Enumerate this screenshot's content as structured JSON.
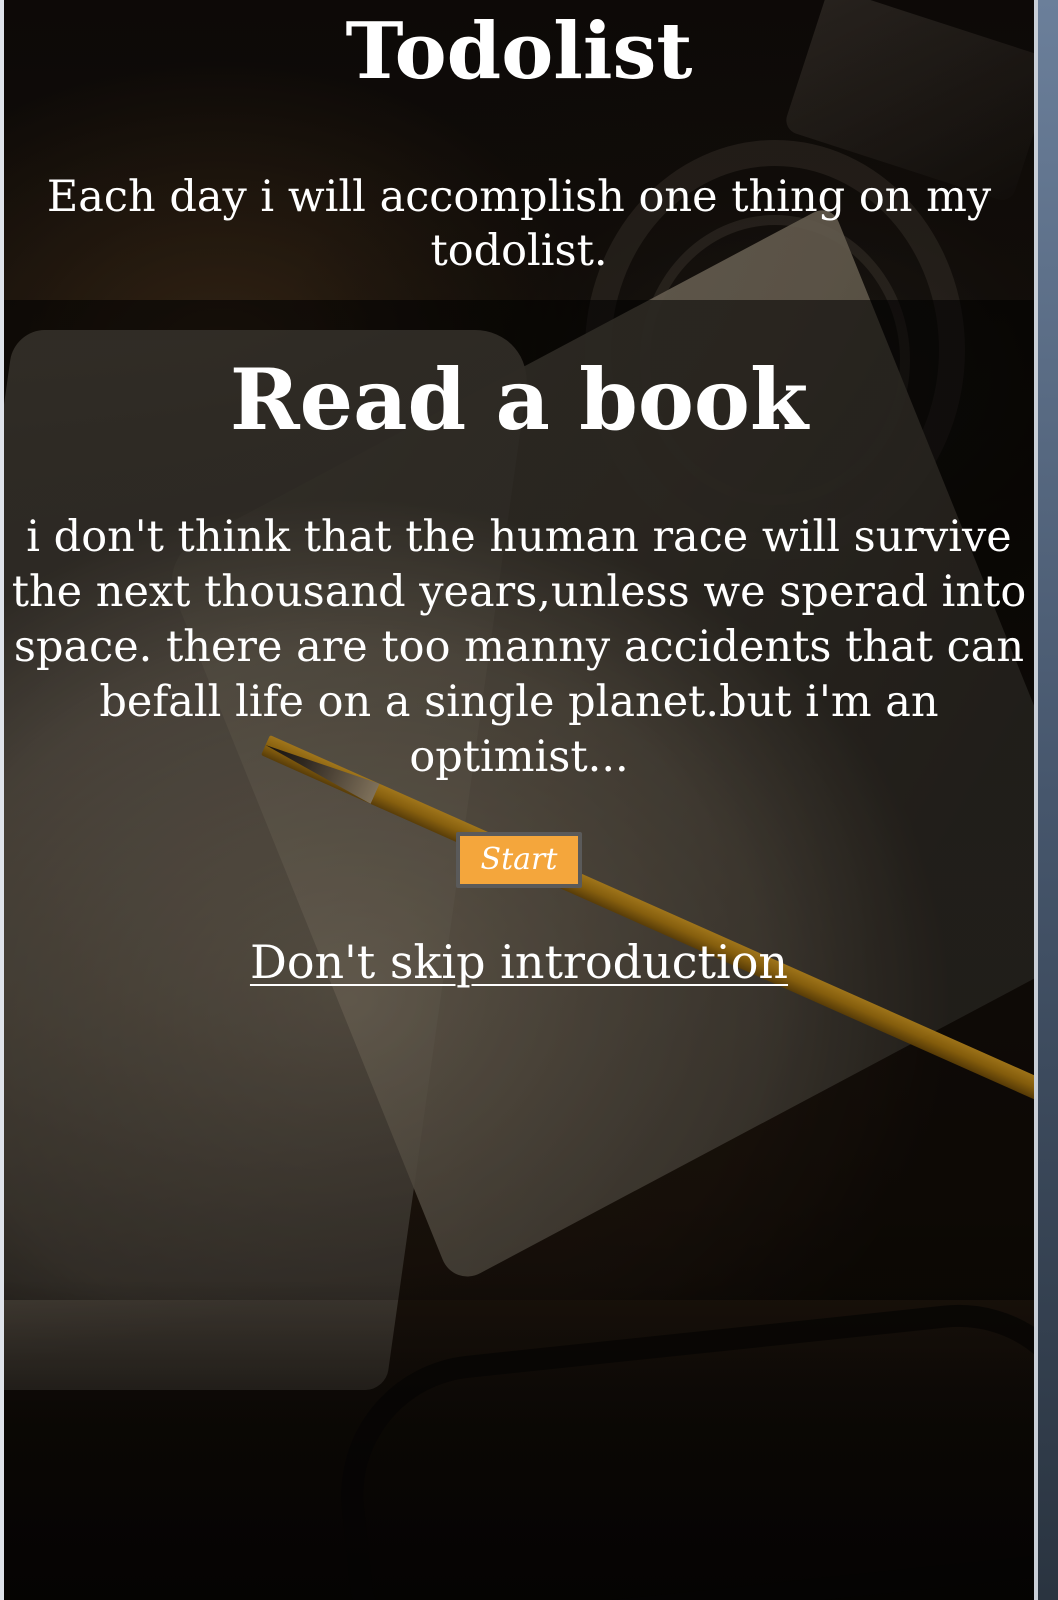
{
  "header": {
    "title": "Todolist",
    "subtitle": "Each day i will accomplish one thing on my todolist."
  },
  "task": {
    "heading": "Read a book",
    "quote": "i don't think that the human race will survive the next thousand years,unless we sperad into space. there are too manny accidents that can befall life on a single planet.but i'm an optimist..."
  },
  "actions": {
    "start_label": "Start",
    "skip_link_label": "Don't skip introduction"
  },
  "colors": {
    "start_button_bg": "#f4a63c",
    "start_button_border": "#5a5a5a",
    "text": "#ffffff"
  }
}
